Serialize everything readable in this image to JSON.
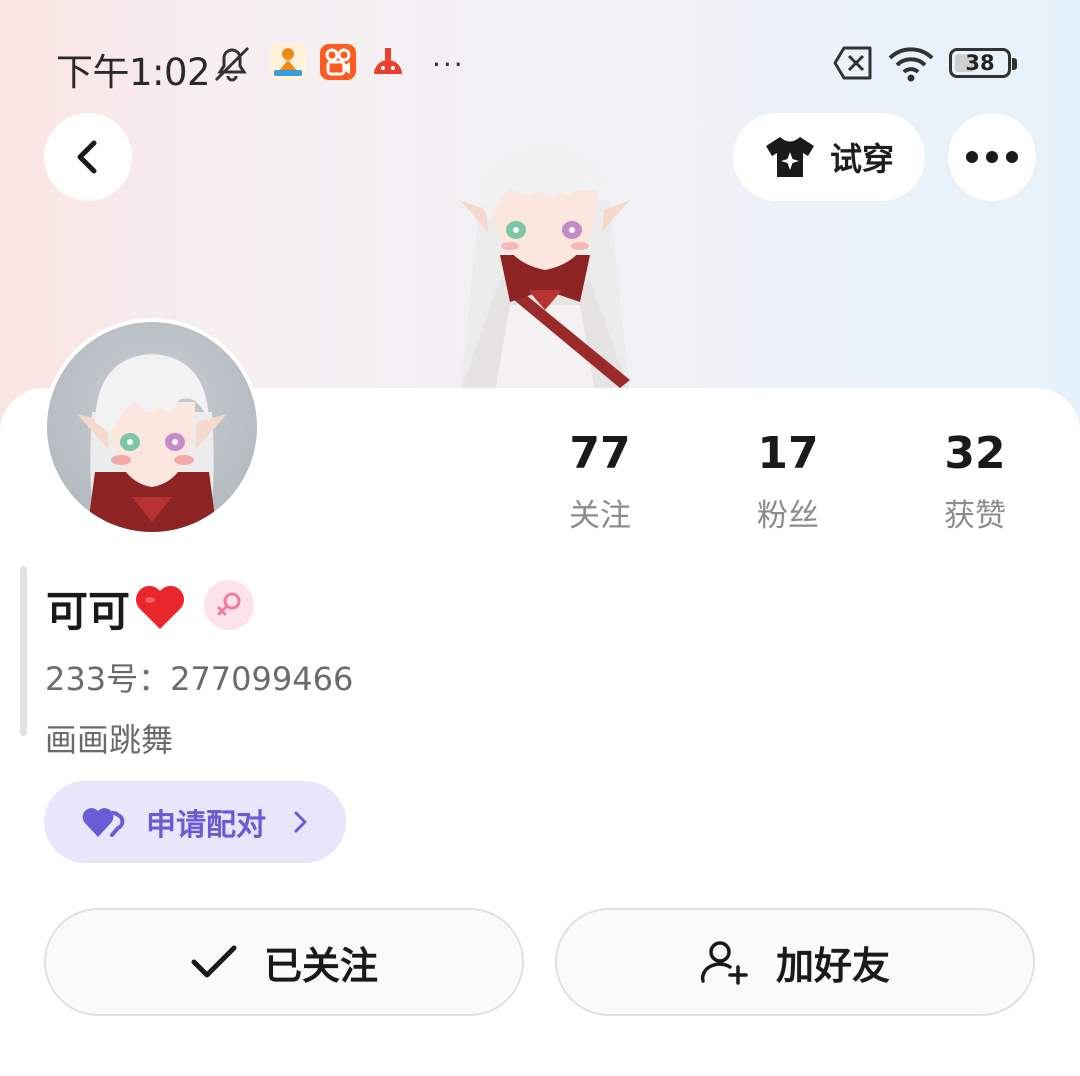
{
  "status_bar": {
    "time": "下午1:02",
    "battery": "38",
    "battery_fraction": 0.38,
    "icons": [
      "mute-icon",
      "app-notification-icon",
      "kuaishou-icon",
      "app-notification-icon",
      "sim-off-icon",
      "wifi-icon"
    ],
    "more": "···"
  },
  "header": {
    "back_icon": "chevron-left-icon",
    "tryon_label": "试穿",
    "tryon_icon": "tshirt-sparkle-icon",
    "more_icon": "more-dots-icon"
  },
  "profile": {
    "name": "可可",
    "name_emoji": "❤️",
    "gender": "female",
    "account": "233号：277099466",
    "bio": "画画跳舞"
  },
  "stats": [
    {
      "value": "77",
      "label": "关注"
    },
    {
      "value": "17",
      "label": "粉丝"
    },
    {
      "value": "32",
      "label": "获赞"
    }
  ],
  "pair": {
    "label": "申请配对",
    "icon": "double-heart-icon",
    "accent": "#6a5bd7"
  },
  "actions": {
    "followed_label": "已关注",
    "followed_icon": "check-icon",
    "add_friend_label": "加好友",
    "add_friend_icon": "add-person-icon"
  }
}
